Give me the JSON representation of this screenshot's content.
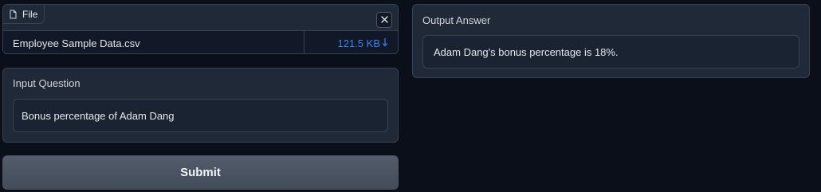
{
  "file_upload": {
    "label": "File",
    "label_icon": "file-icon",
    "clear_icon": "close-icon",
    "file_name": "Employee Sample Data.csv",
    "file_size": "121.5 KB",
    "download_icon": "download-arrow-icon"
  },
  "input_question": {
    "label": "Input Question",
    "value": "Bonus percentage of Adam Dang"
  },
  "submit": {
    "label": "Submit"
  },
  "output_answer": {
    "label": "Output Answer",
    "value": "Adam Dang's bonus percentage is 18%."
  },
  "colors": {
    "background": "#0b0f19",
    "panel": "#1f2937",
    "border": "#374151",
    "link": "#3b82f6",
    "button": "#4b5563"
  }
}
